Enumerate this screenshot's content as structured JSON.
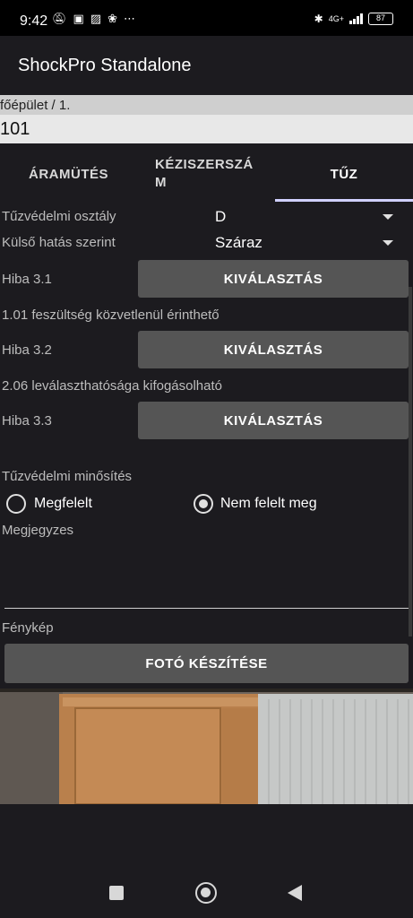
{
  "status_bar": {
    "time": "9:42",
    "left_icons": [
      "silent-bell-icon",
      "notification-icon",
      "notification-icon",
      "fan-icon",
      "more-icon"
    ],
    "network": "4G+",
    "battery": "87"
  },
  "app": {
    "title": "ShockPro Standalone"
  },
  "location": {
    "path": "főépület / 1.",
    "room": "101"
  },
  "tabs": [
    {
      "label": "ÁRAMÜTÉS",
      "selected": false
    },
    {
      "label": "KÉZISZERSZÁM",
      "selected": false
    },
    {
      "label": "TŰZ",
      "selected": true
    }
  ],
  "form": {
    "fire_class": {
      "label": "Tűzvédelmi osztály",
      "value": "D"
    },
    "external_effect": {
      "label": "Külső hatás szerint",
      "value": "Száraz"
    },
    "errors": [
      {
        "label": "Hiba 3.1",
        "button": "KIVÁLASZTÁS",
        "description": "1.01 feszültség közvetlenül érinthető"
      },
      {
        "label": "Hiba 3.2",
        "button": "KIVÁLASZTÁS",
        "description": "2.06 leválaszthatósága kifogásolható"
      },
      {
        "label": "Hiba 3.3",
        "button": "KIVÁLASZTÁS",
        "description": ""
      }
    ],
    "rating": {
      "label": "Tűzvédelmi minősítés",
      "options": [
        {
          "label": "Megfelelt",
          "checked": false
        },
        {
          "label": "Nem felelt meg",
          "checked": true
        }
      ]
    },
    "notes": {
      "label": "Megjegyzes",
      "value": ""
    },
    "photo": {
      "label": "Fénykép",
      "button": "FOTÓ KÉSZÍTÉSE"
    }
  },
  "colors": {
    "background": "#1c1b1f",
    "button": "#555555",
    "tab_indicator": "#d0d0ff"
  }
}
